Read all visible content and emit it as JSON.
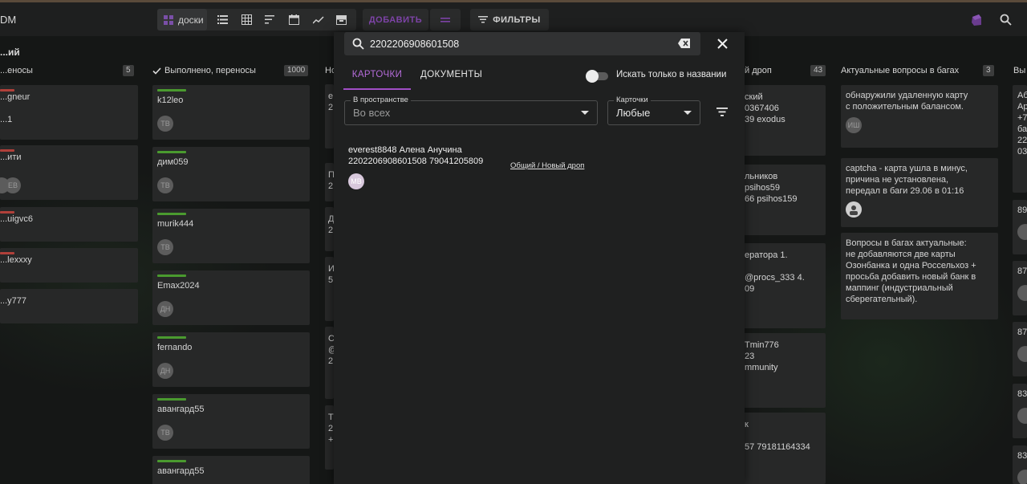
{
  "app": {
    "name": "DM"
  },
  "toolbar": {
    "boards_label": "доски",
    "add_label": "ДОБАВИТЬ",
    "filters_label": "ФИЛЬТРЫ"
  },
  "columns": [
    {
      "title": "...ий",
      "subtitle": "...еносы",
      "count": "5",
      "cards": [
        {
          "text": "...gneur",
          "line2": "...1",
          "avatars": []
        },
        {
          "text": "...ити",
          "avatars": [
            "ЕВ"
          ]
        },
        {
          "text": "...uigvc6",
          "avatars": []
        },
        {
          "text": "...lexxxy",
          "avatars": []
        },
        {
          "text": "...y777",
          "avatars": []
        }
      ]
    },
    {
      "title": "Выполнено, переносы",
      "count": "1000",
      "cards": [
        {
          "text": "k12leo",
          "avatar": "ТВ"
        },
        {
          "text": "дим059",
          "avatar": "ТВ"
        },
        {
          "text": "murik444",
          "avatar": "ТВ"
        },
        {
          "text": "Emax2024",
          "avatar": "ДН"
        },
        {
          "text": "fernando",
          "avatar": "ДН"
        },
        {
          "text": "авангард55",
          "avatar": "ТВ"
        },
        {
          "text": "авангард55",
          "avatar": ""
        }
      ]
    },
    {
      "title": "Но",
      "cards": [
        {
          "text": "е",
          "line2": "2"
        },
        {
          "text": "П",
          "line2": "2"
        },
        {
          "text": "Д",
          "line2": "2"
        },
        {
          "text": "И",
          "line2": "5"
        },
        {
          "text": "С",
          "line2": "@",
          "line3": "2"
        },
        {
          "text": "Т",
          "line2": "2",
          "line3": "+"
        }
      ]
    },
    {
      "title": "й дроп",
      "count": "43",
      "cards": [
        {
          "line1": "ский",
          "line2": "0367406",
          "line3": "39 exodus"
        },
        {
          "line1": "льников",
          "line2": "psihos59",
          "line3": "66 psihos159"
        },
        {
          "line1": "ератора 1.",
          "line2": "",
          "line3": "@procs_333 4.",
          "line4": "09"
        },
        {
          "line1": "Tmin776",
          "line2": "23",
          "line3": "mmunity"
        },
        {
          "line1": "к",
          "line2": "",
          "line3": "57 79181164334"
        }
      ]
    },
    {
      "title": "Актуальные вопросы в багах",
      "count": "3",
      "cards": [
        {
          "lines": [
            "обнаружили удаленную карту",
            "с положительным балансом."
          ],
          "avatar": "ИШ"
        },
        {
          "lines": [
            "captcha - карта ушла в минус,",
            "причина не установлена,",
            "передал в баги 29.06 в 01:16"
          ],
          "avatar": "photo"
        },
        {
          "lines": [
            "Вопросы в багах актуальные:",
            "не добавляются две карты",
            "Озонбанка и одна Россельхоз +",
            "просьба добавить новый банк в",
            "маппинг (индустриальный",
            "сберегательный)."
          ]
        }
      ]
    },
    {
      "title": "Вы",
      "cards": [
        {
          "lines": [
            "Аб",
            "Ар",
            "+7",
            "ба",
            "22",
            "03"
          ]
        },
        {
          "lines": [
            "89"
          ]
        },
        {
          "lines": [
            "87"
          ]
        },
        {
          "lines": [
            "87"
          ]
        },
        {
          "lines": [
            "83"
          ]
        },
        {
          "lines": [
            "83"
          ]
        }
      ]
    }
  ],
  "search": {
    "query": "2202206908601508",
    "tabs": [
      {
        "label": "КАРТОЧКИ",
        "active": true
      },
      {
        "label": "ДОКУМЕНТЫ",
        "active": false
      }
    ],
    "toggle_label": "Искать только в названии",
    "toggle_on": false,
    "space_field": {
      "label": "В пространстве",
      "value": "Во всех"
    },
    "cards_field": {
      "label": "Карточки",
      "value": "Любые"
    },
    "results": [
      {
        "line1": "everest8848 Алена Анучина",
        "line2": "2202206908601508 79041205809",
        "path": "Общий / Новый дроп",
        "avatar": "МВ"
      }
    ]
  },
  "colors": {
    "accent": "#a14ec6",
    "stripe_green": "#4a9a2f",
    "stripe_red": "#b0403a"
  }
}
